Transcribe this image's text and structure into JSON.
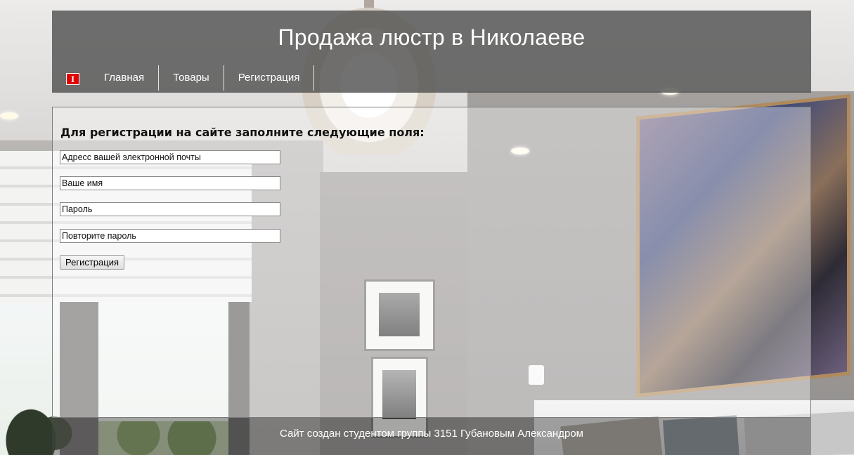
{
  "header": {
    "title": "Продажа люстр в Николаеве",
    "logo_glyph": "I"
  },
  "nav": {
    "items": [
      {
        "label": "Главная"
      },
      {
        "label": "Товары"
      },
      {
        "label": "Регистрация"
      }
    ]
  },
  "form": {
    "heading": "Для регистрации на сайте заполните следующие поля:",
    "fields": {
      "email_placeholder": "Адресс вашей электронной почты",
      "name_placeholder": "Ваше имя",
      "password_placeholder": "Пароль",
      "password_repeat_placeholder": "Повторите пароль"
    },
    "submit_label": "Регистрация"
  },
  "footer": {
    "text": "Сайт создан студентом группы 3151 Губановым Александром"
  },
  "colors": {
    "header_bg": "#525252",
    "logo_red": "#e00000",
    "text_light": "#ffffff"
  }
}
